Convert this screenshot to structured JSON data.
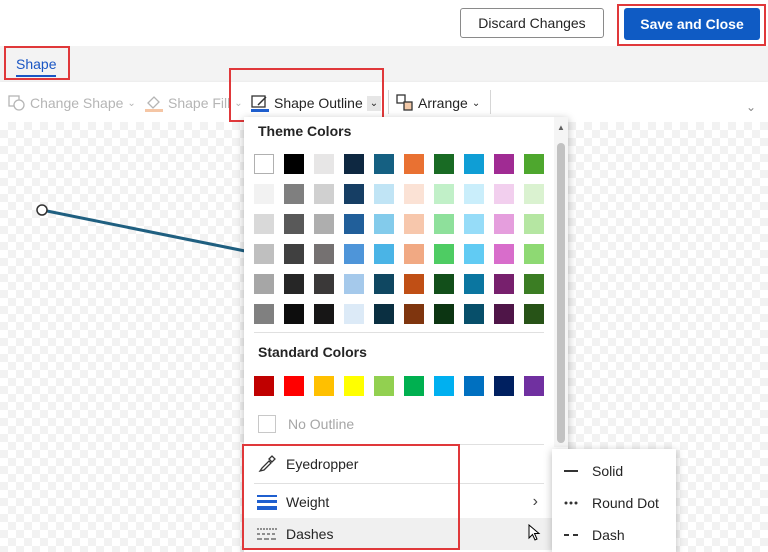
{
  "topbar": {
    "discard_label": "Discard Changes",
    "save_label": "Save and Close"
  },
  "tabs": {
    "shape_label": "Shape"
  },
  "ribbon": {
    "change_shape": "Change Shape",
    "shape_fill": "Shape Fill",
    "shape_outline": "Shape Outline",
    "arrange": "Arrange"
  },
  "dropdown": {
    "theme_heading": "Theme Colors",
    "standard_heading": "Standard Colors",
    "no_outline": "No Outline",
    "eyedropper": "Eyedropper",
    "weight": "Weight",
    "dashes": "Dashes",
    "theme_colors": [
      [
        "#ffffff",
        "#000000",
        "#e7e6e6",
        "#0e2841",
        "#156082",
        "#e97132",
        "#196b24",
        "#0f9ed5",
        "#a02b93",
        "#4ea72e"
      ],
      [
        "#f2f2f2",
        "#7f7f7f",
        "#d0d0d0",
        "#163e64",
        "#c0e4f5",
        "#fbe2d5",
        "#c1f0c8",
        "#caeefb",
        "#f2cfee",
        "#daf2d0"
      ],
      [
        "#d9d9d9",
        "#595959",
        "#aeaeae",
        "#215f9a",
        "#83cbeb",
        "#f7c7ac",
        "#8ee09b",
        "#96dcf8",
        "#e59edd",
        "#b5e6a2"
      ],
      [
        "#bfbfbf",
        "#404040",
        "#757171",
        "#4e95d9",
        "#4ab4e6",
        "#f1a983",
        "#4ecc63",
        "#61cbf3",
        "#d86dcb",
        "#8ed973"
      ],
      [
        "#a6a6a6",
        "#262626",
        "#3a3838",
        "#a5c9eb",
        "#0f4761",
        "#c04f15",
        "#124f1a",
        "#0b76a0",
        "#77206d",
        "#3b7d23"
      ],
      [
        "#808080",
        "#0d0d0d",
        "#171616",
        "#dceaf7",
        "#0a2f41",
        "#7f350e",
        "#0c3512",
        "#074f6a",
        "#4f1548",
        "#275317"
      ]
    ],
    "standard_colors": [
      "#c00000",
      "#ff0000",
      "#ffc000",
      "#ffff00",
      "#92d050",
      "#00b050",
      "#00b0f0",
      "#0070c0",
      "#002060",
      "#7030a0"
    ]
  },
  "submenu": {
    "solid": "Solid",
    "round_dot": "Round Dot",
    "dash": "Dash"
  },
  "colors": {
    "accent": "#0f5bc4",
    "highlight": "#e0383a",
    "line": "#1f5f80"
  }
}
